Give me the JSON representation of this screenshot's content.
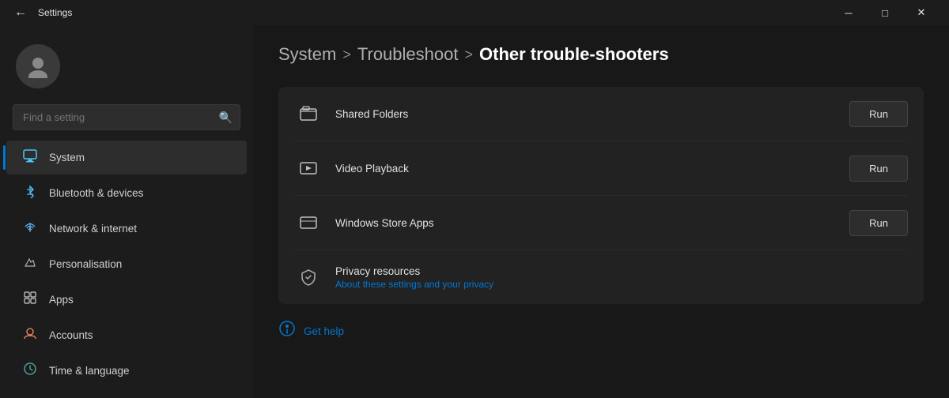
{
  "titlebar": {
    "back_label": "←",
    "title": "Settings",
    "min_label": "─",
    "max_label": "□",
    "close_label": "✕"
  },
  "sidebar": {
    "search_placeholder": "Find a setting",
    "search_icon": "🔍",
    "nav_items": [
      {
        "id": "system",
        "label": "System",
        "icon": "💻",
        "icon_class": "icon-system",
        "active": true
      },
      {
        "id": "bluetooth",
        "label": "Bluetooth & devices",
        "icon": "✱",
        "icon_class": "icon-bluetooth",
        "active": false
      },
      {
        "id": "network",
        "label": "Network & internet",
        "icon": "◈",
        "icon_class": "icon-network",
        "active": false
      },
      {
        "id": "personalisation",
        "label": "Personalisation",
        "icon": "✏",
        "icon_class": "icon-personalisation",
        "active": false
      },
      {
        "id": "apps",
        "label": "Apps",
        "icon": "⊞",
        "icon_class": "icon-apps",
        "active": false
      },
      {
        "id": "accounts",
        "label": "Accounts",
        "icon": "◉",
        "icon_class": "icon-accounts",
        "active": false
      },
      {
        "id": "time",
        "label": "Time & language",
        "icon": "🌐",
        "icon_class": "icon-time",
        "active": false
      }
    ]
  },
  "breadcrumb": {
    "crumb1": "System",
    "sep1": ">",
    "crumb2": "Troubleshoot",
    "sep2": ">",
    "current": "Other trouble-shooters"
  },
  "troubleshooters": [
    {
      "id": "shared-folders",
      "label": "Shared Folders",
      "icon": "🖨",
      "has_run": true,
      "run_label": "Run"
    },
    {
      "id": "video-playback",
      "label": "Video Playback",
      "icon": "▭",
      "has_run": true,
      "run_label": "Run"
    },
    {
      "id": "windows-store",
      "label": "Windows Store Apps",
      "icon": "▭",
      "has_run": true,
      "run_label": "Run"
    },
    {
      "id": "privacy-resources",
      "label": "Privacy resources",
      "subtext": "About these settings and your privacy",
      "icon": "🛡",
      "has_run": false
    }
  ],
  "get_help": {
    "label": "Get help",
    "icon": "💬"
  }
}
